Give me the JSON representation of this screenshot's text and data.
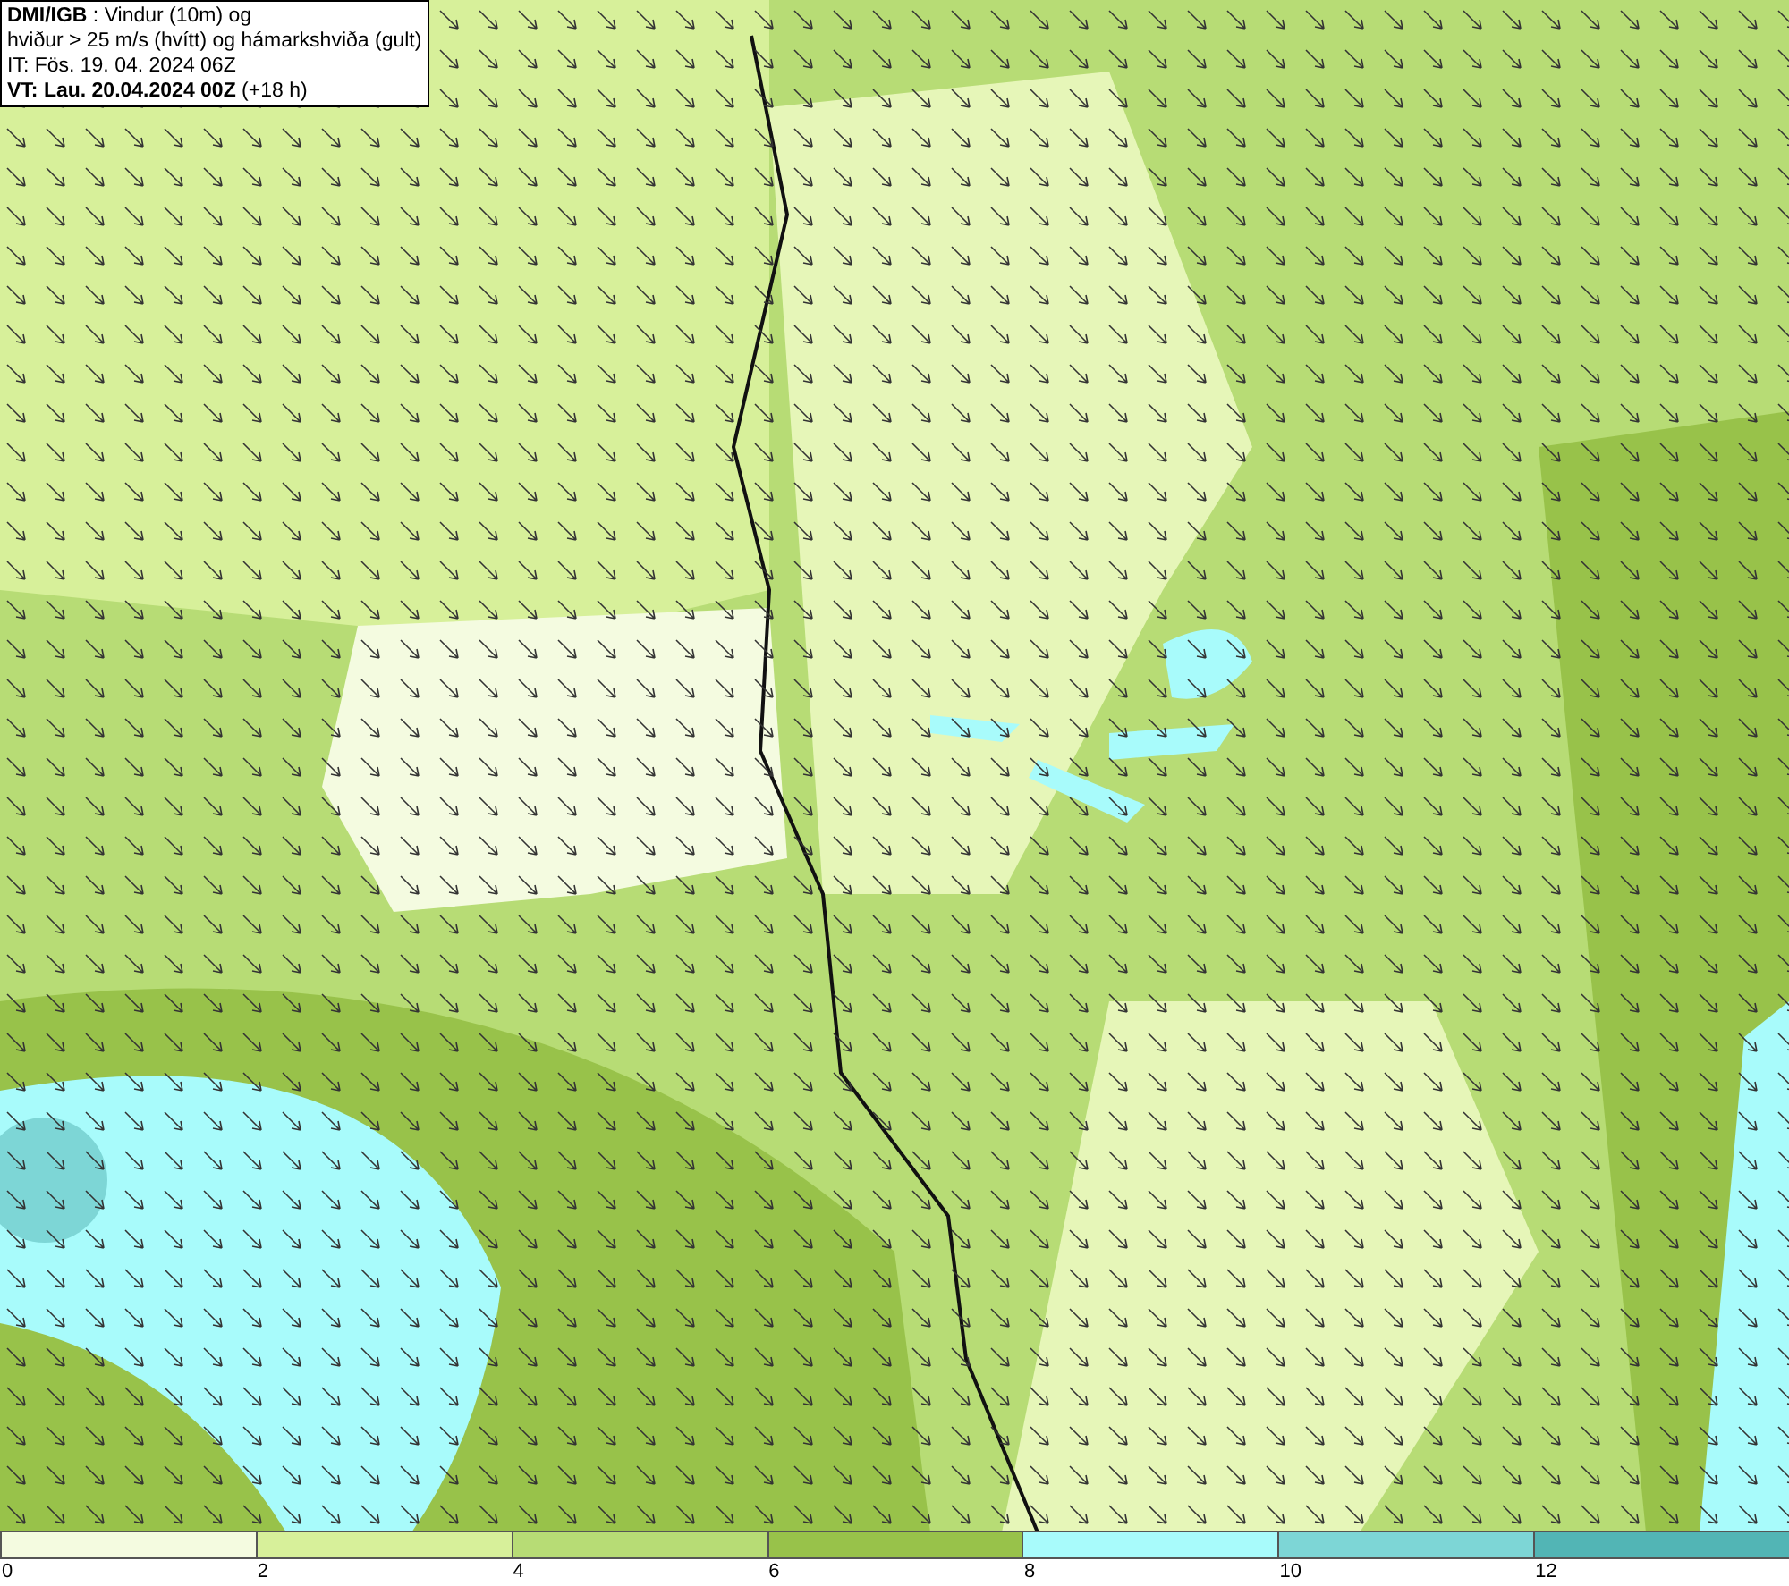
{
  "title_box": {
    "lines": [
      "**DMI/IGB** : Vindur (10m) og",
      "hviður > 25 m/s (hvítt) og hámarkshviða (gult)",
      "IT: Fös. 19. 04. 2024 06Z",
      "**VT: Lau. 20.04.2024 00Z** (+18 h)"
    ]
  },
  "legend": {
    "bins": [
      {
        "color": "#f4fbe0"
      },
      {
        "color": "#d7f09a"
      },
      {
        "color": "#b7dc75"
      },
      {
        "color": "#98c24a"
      },
      {
        "color": "#a8fbfb"
      },
      {
        "color": "#7dd6d6"
      },
      {
        "color": "#52b5b5"
      }
    ],
    "ticks": [
      "0",
      "2",
      "4",
      "6",
      "8",
      "10",
      "12"
    ]
  }
}
